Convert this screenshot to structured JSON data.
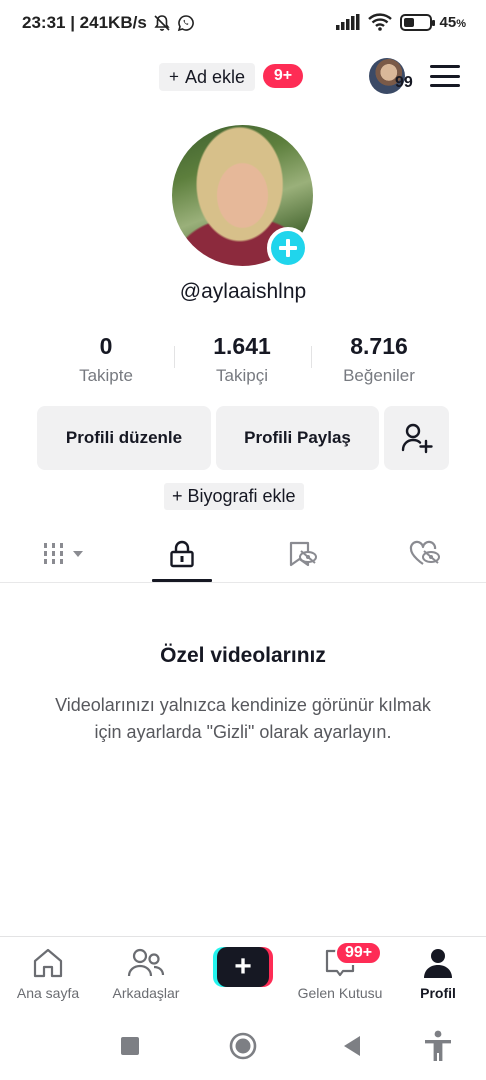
{
  "status_bar": {
    "time_speed": "23:31 | 241KB/s",
    "battery": "45",
    "battery_unit": "%",
    "battery_level": 0.45
  },
  "top_bar": {
    "add_account_label": "Ad ekle",
    "add_account_plus": "+",
    "notif_count": "9+",
    "avatar_count": "99"
  },
  "profile": {
    "username": "@aylaaishlnp"
  },
  "stats": {
    "following_value": "0",
    "following_label": "Takipte",
    "followers_value": "1.641",
    "followers_label": "Takipçi",
    "likes_value": "8.716",
    "likes_label": "Beğeniler"
  },
  "actions": {
    "edit_profile": "Profili düzenle",
    "share_profile": "Profili Paylaş"
  },
  "bio": {
    "add_label": "+ Biyografi ekle"
  },
  "empty_state": {
    "title": "Özel videolarınız",
    "description": "Videolarınızı yalnızca kendinize görünür kılmak için ayarlarda \"Gizli\" olarak ayarlayın."
  },
  "bottom_nav": {
    "home": "Ana sayfa",
    "friends": "Arkadaşlar",
    "create": "+",
    "inbox": "Gelen Kutusu",
    "inbox_badge": "99+",
    "profile": "Profil"
  },
  "colors": {
    "accent": "#fe2c55",
    "cyan": "#20d5ec",
    "text": "#161823"
  }
}
